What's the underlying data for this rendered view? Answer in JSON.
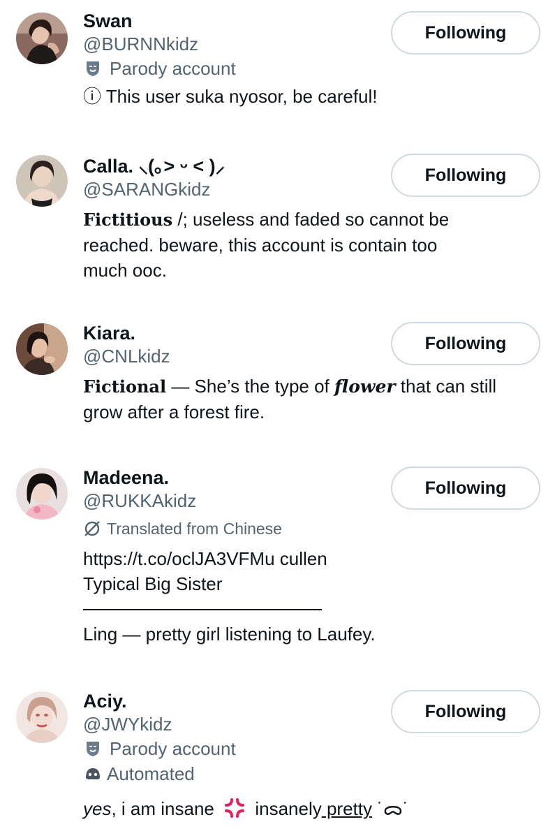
{
  "follow_button_label": "Following",
  "users": [
    {
      "name": "Swan",
      "handle": "@BURNNkidz",
      "parody_label": "Parody account",
      "bio": {
        "info_text": "ⓘ This user suka nyosor, be careful!"
      }
    },
    {
      "name": "Calla. ⸜(｡˃ ᵕ ˂ )⸝",
      "handle": "@SARANGkidz",
      "bio": {
        "word": "𝐅𝐢𝐜𝐭𝐢𝐭𝐢𝐨𝐮𝐬",
        "line1": " /; useless and faded so cannot be",
        "line2": "reached. beware, this account is contain too",
        "line3": "much ooc."
      }
    },
    {
      "name": "Kiara.",
      "handle": "@CNLkidz",
      "bio": {
        "word": "𝐅𝐢𝐜𝐭𝐢𝐨𝐧𝐚𝐥",
        "mid": " — She’s the type of ",
        "flower": "𝒇𝒍𝒐𝒘𝒆𝒓",
        "end": " that can still",
        "line2": "grow after a forest fire."
      }
    },
    {
      "name": "Madeena.",
      "handle": "@RUKKAkidz",
      "translated_label": "Translated from Chinese",
      "bio": {
        "line1": "https://t.co/oclJA3VFMu cullen",
        "line2": "Typical Big Sister",
        "line3": "Ling — pretty girl listening to Laufey."
      }
    },
    {
      "name": "Aciy.",
      "handle": "@JWYkidz",
      "parody_label": "Parody account",
      "automated_label": "Automated",
      "bio": {
        "yes": "yes",
        "part1": ", i am insane ",
        "part2": " insanely",
        "pretty": " pretty",
        "face": " ˙ᯅ˙"
      }
    }
  ]
}
